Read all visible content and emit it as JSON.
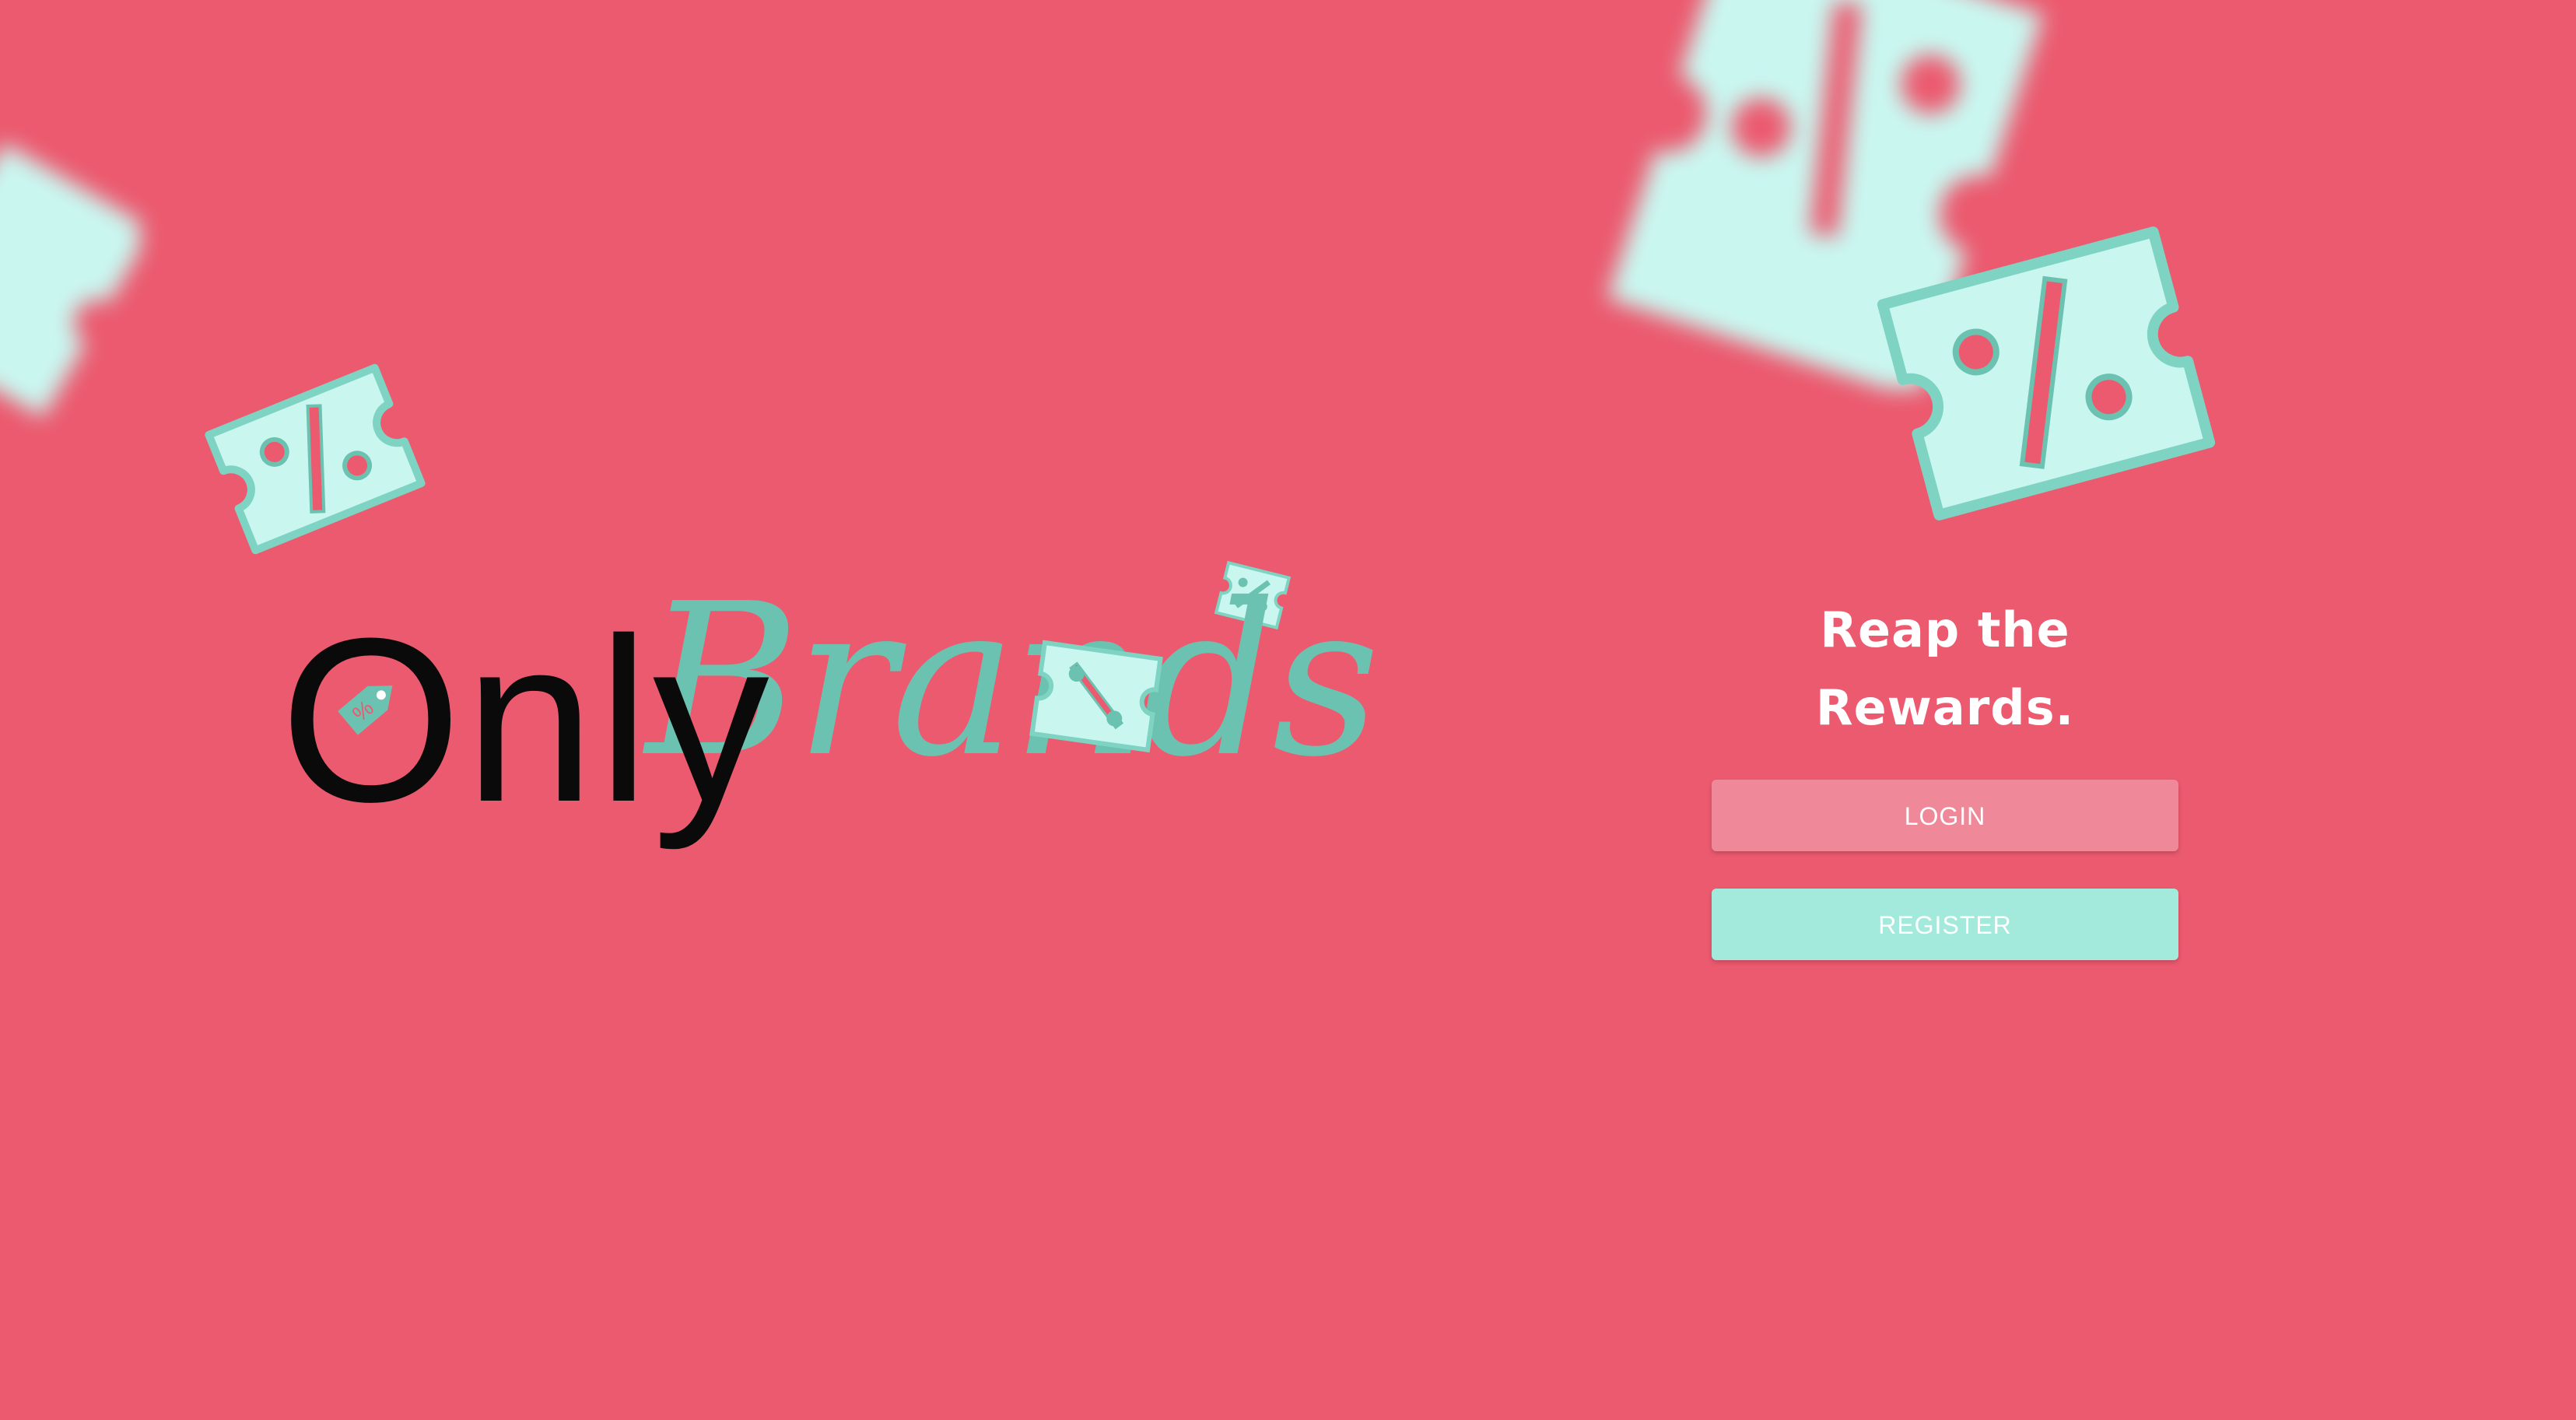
{
  "brand": {
    "name_part1": "Only",
    "name_part2": "Brands"
  },
  "hero": {
    "tagline": "Reap the Rewards."
  },
  "actions": {
    "login_label": "LOGIN",
    "register_label": "REGISTER"
  },
  "colors": {
    "background": "#ec5a6f",
    "accent_mint": "#c9f7f0",
    "accent_teal": "#6cc2b1",
    "login_button": "#ef8898",
    "register_button": "#a3e9dc"
  },
  "icons": {
    "decorative": "discount-coupon-icon",
    "logo_mark": "price-tag-icon"
  }
}
